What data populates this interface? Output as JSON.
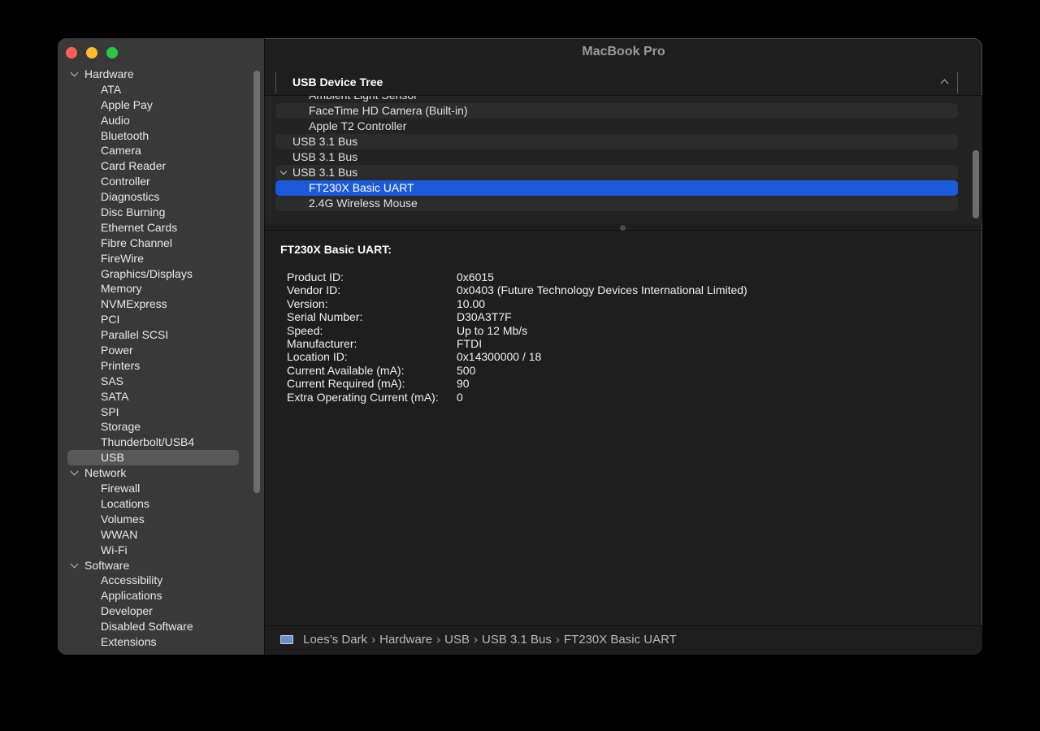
{
  "window": {
    "title": "MacBook Pro"
  },
  "sidebar": {
    "groups": [
      {
        "label": "Hardware",
        "items": [
          "ATA",
          "Apple Pay",
          "Audio",
          "Bluetooth",
          "Camera",
          "Card Reader",
          "Controller",
          "Diagnostics",
          "Disc Burning",
          "Ethernet Cards",
          "Fibre Channel",
          "FireWire",
          "Graphics/Displays",
          "Memory",
          "NVMExpress",
          "PCI",
          "Parallel SCSI",
          "Power",
          "Printers",
          "SAS",
          "SATA",
          "SPI",
          "Storage",
          "Thunderbolt/USB4",
          "USB"
        ]
      },
      {
        "label": "Network",
        "items": [
          "Firewall",
          "Locations",
          "Volumes",
          "WWAN",
          "Wi-Fi"
        ]
      },
      {
        "label": "Software",
        "items": [
          "Accessibility",
          "Applications",
          "Developer",
          "Disabled Software",
          "Extensions"
        ]
      }
    ],
    "selected": "USB"
  },
  "device_tree": {
    "header": "USB Device Tree",
    "rows": [
      {
        "label": "Ambient Light Sensor",
        "level": 2
      },
      {
        "label": "FaceTime HD Camera (Built-in)",
        "level": 2
      },
      {
        "label": "Apple T2 Controller",
        "level": 2
      },
      {
        "label": "USB 3.1 Bus",
        "level": 1
      },
      {
        "label": "USB 3.1 Bus",
        "level": 1
      },
      {
        "label": "USB 3.1 Bus",
        "level": 1,
        "expanded": true
      },
      {
        "label": "FT230X Basic UART",
        "level": 2,
        "selected": true
      },
      {
        "label": "2.4G Wireless Mouse",
        "level": 2
      }
    ]
  },
  "details": {
    "title": "FT230X Basic UART:",
    "fields": [
      {
        "key": "Product ID:",
        "value": "0x6015"
      },
      {
        "key": "Vendor ID:",
        "value": "0x0403  (Future Technology Devices International Limited)"
      },
      {
        "key": "Version:",
        "value": "10.00"
      },
      {
        "key": "Serial Number:",
        "value": "D30A3T7F"
      },
      {
        "key": "Speed:",
        "value": "Up to 12 Mb/s"
      },
      {
        "key": "Manufacturer:",
        "value": "FTDI"
      },
      {
        "key": "Location ID:",
        "value": "0x14300000 / 18"
      },
      {
        "key": "Current Available (mA):",
        "value": "500"
      },
      {
        "key": "Current Required (mA):",
        "value": "90"
      },
      {
        "key": "Extra Operating Current (mA):",
        "value": "0"
      }
    ]
  },
  "path_bar": {
    "icon": "laptop-icon",
    "crumbs": [
      "Loes’s Dark",
      "Hardware",
      "USB",
      "USB 3.1 Bus",
      "FT230X Basic UART"
    ]
  },
  "colors": {
    "selection": "#1b5bd9",
    "sidebar_bg": "#393939",
    "content_bg": "#1e1e1e"
  }
}
